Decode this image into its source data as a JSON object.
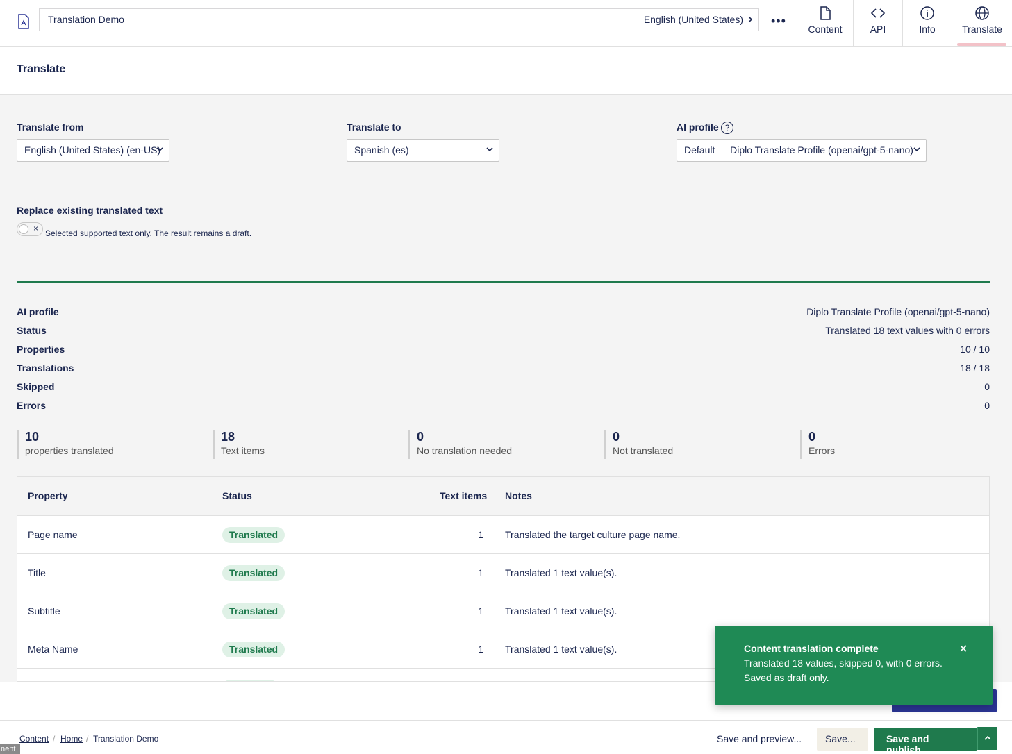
{
  "header": {
    "document_name": "Translation Demo",
    "culture": "English (United States)",
    "more_label": "•••",
    "tabs": [
      {
        "label": "Content",
        "icon": "document-icon"
      },
      {
        "label": "API",
        "icon": "code-icon"
      },
      {
        "label": "Info",
        "icon": "info-icon"
      },
      {
        "label": "Translate",
        "icon": "globe-icon"
      }
    ]
  },
  "page": {
    "title": "Translate"
  },
  "form": {
    "from_label": "Translate from",
    "from_value": "English (United States) (en-US)",
    "to_label": "Translate to",
    "to_value": "Spanish (es)",
    "profile_label": "AI profile",
    "profile_help": "?",
    "profile_value": "Default — Diplo Translate Profile (openai/gpt-5-nano)",
    "replace_label": "Replace existing translated text",
    "toggle_state": "×",
    "replace_desc": "Selected supported text only. The result remains a draft."
  },
  "summary": [
    {
      "label": "AI profile",
      "value": "Diplo Translate Profile (openai/gpt-5-nano)"
    },
    {
      "label": "Status",
      "value": "Translated 18 text values with 0 errors"
    },
    {
      "label": "Properties",
      "value": "10 / 10"
    },
    {
      "label": "Translations",
      "value": "18 / 18"
    },
    {
      "label": "Skipped",
      "value": "0"
    },
    {
      "label": "Errors",
      "value": "0"
    }
  ],
  "stats": [
    {
      "num": "10",
      "label": "properties translated"
    },
    {
      "num": "18",
      "label": "Text items"
    },
    {
      "num": "0",
      "label": "No translation needed"
    },
    {
      "num": "0",
      "label": "Not translated"
    },
    {
      "num": "0",
      "label": "Errors"
    }
  ],
  "table": {
    "headers": [
      "Property",
      "Status",
      "Text items",
      "Notes"
    ],
    "rows": [
      {
        "property": "Page name",
        "status": "Translated",
        "items": "1",
        "notes": "Translated the target culture page name."
      },
      {
        "property": "Title",
        "status": "Translated",
        "items": "1",
        "notes": "Translated 1 text value(s)."
      },
      {
        "property": "Subtitle",
        "status": "Translated",
        "items": "1",
        "notes": "Translated 1 text value(s)."
      },
      {
        "property": "Meta Name",
        "status": "Translated",
        "items": "1",
        "notes": "Translated 1 text value(s)."
      }
    ]
  },
  "toast": {
    "title": "Content translation complete",
    "line1": "Translated 18 values, skipped 0, with 0 errors.",
    "line2": "Saved as draft only."
  },
  "footer": {
    "breadcrumbs": [
      "Content",
      "Home",
      "Translation Demo"
    ],
    "save_preview": "Save and preview...",
    "save": "Save...",
    "save_publish": "Save and publish...",
    "corner_tag": "nent"
  },
  "colors": {
    "accent_green": "#1f7a4d",
    "toast_green": "#1f8a55",
    "text_navy": "#1b264f",
    "badge_bg": "#dff1e6",
    "blue_button": "#2b3595"
  }
}
